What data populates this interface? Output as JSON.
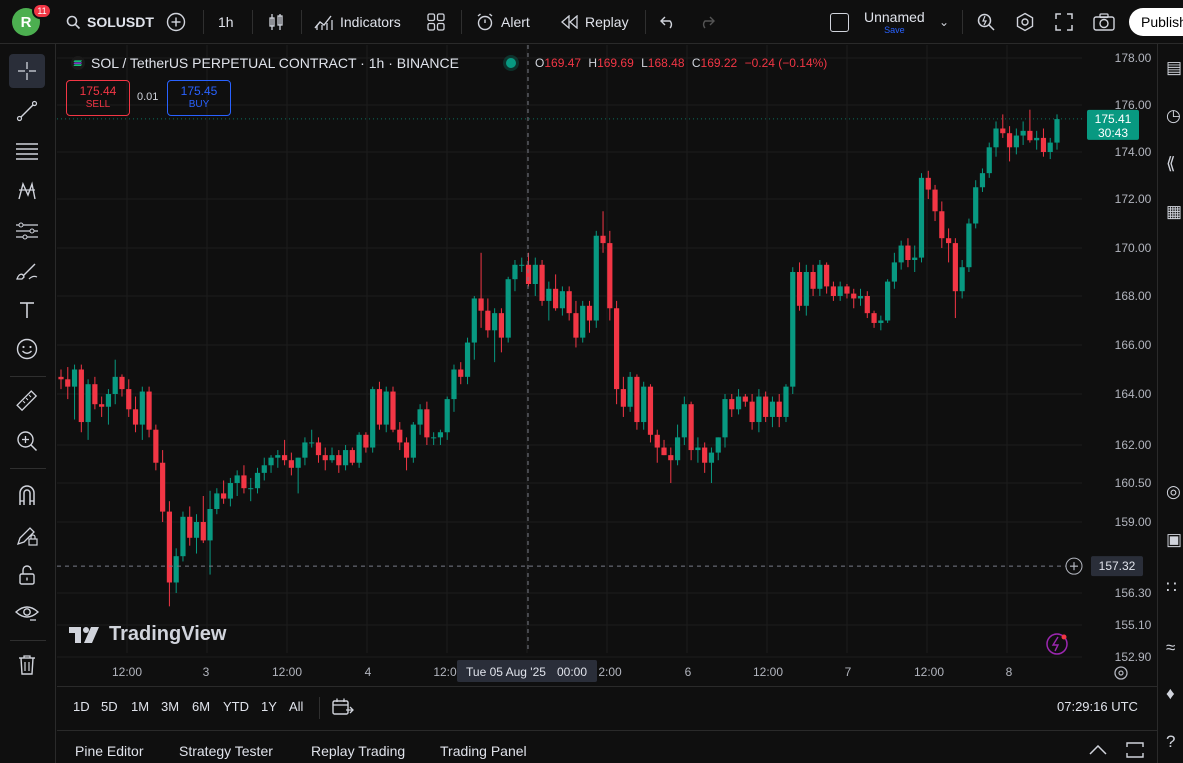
{
  "header": {
    "avatar_letter": "R",
    "notification_count": "11",
    "symbol": "SOLUSDT",
    "interval": "1h",
    "indicators_label": "Indicators",
    "alert_label": "Alert",
    "replay_label": "Replay",
    "layout_name": "Unnamed",
    "save_label": "Save",
    "publish_label": "Publish"
  },
  "legend": {
    "title": "SOL / TetherUS PERPETUAL CONTRACT · 1h · BINANCE",
    "open_key": "O",
    "open": "169.47",
    "high_key": "H",
    "high": "169.69",
    "low_key": "L",
    "low": "168.48",
    "close_key": "C",
    "close": "169.22",
    "change": "−0.24 (−0.14%)"
  },
  "trade": {
    "sell_price": "175.44",
    "sell_label": "SELL",
    "spread": "0.01",
    "buy_price": "175.45",
    "buy_label": "BUY"
  },
  "price_axis": {
    "ticks": [
      "178.00",
      "176.00",
      "174.00",
      "172.00",
      "170.00",
      "168.00",
      "166.00",
      "164.00",
      "162.00",
      "160.50",
      "159.00",
      "156.30",
      "155.10",
      "152.90"
    ],
    "last_price": "175.41",
    "countdown": "30:43",
    "crosshair_price": "157.32"
  },
  "time_axis": {
    "labels": [
      "12:00",
      "3",
      "12:00",
      "4",
      "12:0",
      "2:00",
      "6",
      "12:00",
      "7",
      "12:00",
      "8"
    ],
    "crosshair_date": "Tue 05 Aug '25",
    "crosshair_time": "00:00"
  },
  "watermark": "TradingView",
  "ranges": [
    "1D",
    "5D",
    "1M",
    "3M",
    "6M",
    "YTD",
    "1Y",
    "All"
  ],
  "clock": "07:29:16 UTC",
  "bottom_tabs": [
    "Pine Editor",
    "Strategy Tester",
    "Replay Trading",
    "Trading Panel"
  ],
  "colors": {
    "up": "#089981",
    "down": "#f23645",
    "background": "#0f0f0f",
    "accent": "#2962ff"
  },
  "chart_data": {
    "type": "candlestick",
    "symbol": "SOLUSDT",
    "interval": "1h",
    "ylim": [
      152.9,
      178.0
    ],
    "candles": [
      [
        164.7,
        165.0,
        164.2,
        164.6
      ],
      [
        164.6,
        165.1,
        163.8,
        164.3
      ],
      [
        164.3,
        165.2,
        163.0,
        165.0
      ],
      [
        165.0,
        165.2,
        162.5,
        162.9
      ],
      [
        162.9,
        164.6,
        162.2,
        164.4
      ],
      [
        164.4,
        164.7,
        163.4,
        163.6
      ],
      [
        163.6,
        163.9,
        163.1,
        163.5
      ],
      [
        163.5,
        164.2,
        162.8,
        164.0
      ],
      [
        164.0,
        165.4,
        163.6,
        164.7
      ],
      [
        164.7,
        164.8,
        163.9,
        164.2
      ],
      [
        164.2,
        164.6,
        163.1,
        163.4
      ],
      [
        163.4,
        163.9,
        162.5,
        162.8
      ],
      [
        162.8,
        164.3,
        162.2,
        164.1
      ],
      [
        164.1,
        164.3,
        162.3,
        162.6
      ],
      [
        162.6,
        162.8,
        161.0,
        161.3
      ],
      [
        161.3,
        161.8,
        159.0,
        159.4
      ],
      [
        159.4,
        159.8,
        155.8,
        156.7
      ],
      [
        156.7,
        158.0,
        156.3,
        157.7
      ],
      [
        157.7,
        159.4,
        157.5,
        159.2
      ],
      [
        159.2,
        159.6,
        158.1,
        158.4
      ],
      [
        158.4,
        159.3,
        157.8,
        159.0
      ],
      [
        159.0,
        160.0,
        158.2,
        158.3
      ],
      [
        158.3,
        160.2,
        157.0,
        159.5
      ],
      [
        159.5,
        160.3,
        159.3,
        160.1
      ],
      [
        160.1,
        160.6,
        159.7,
        159.9
      ],
      [
        159.9,
        160.7,
        159.6,
        160.5
      ],
      [
        160.5,
        161.0,
        160.0,
        160.8
      ],
      [
        160.8,
        161.2,
        160.1,
        160.3
      ],
      [
        160.3,
        160.7,
        159.8,
        160.3
      ],
      [
        160.3,
        161.1,
        160.1,
        160.9
      ],
      [
        160.9,
        161.5,
        160.6,
        161.2
      ],
      [
        161.2,
        161.6,
        160.9,
        161.5
      ],
      [
        161.5,
        161.8,
        161.1,
        161.6
      ],
      [
        161.6,
        162.2,
        161.2,
        161.4
      ],
      [
        161.4,
        161.7,
        160.8,
        161.1
      ],
      [
        161.1,
        161.5,
        160.1,
        161.5
      ],
      [
        161.5,
        162.3,
        161.2,
        162.1
      ],
      [
        162.1,
        162.6,
        161.9,
        162.1
      ],
      [
        162.1,
        162.3,
        161.3,
        161.6
      ],
      [
        161.6,
        161.9,
        161.0,
        161.4
      ],
      [
        161.4,
        161.9,
        161.3,
        161.6
      ],
      [
        161.6,
        161.8,
        160.9,
        161.2
      ],
      [
        161.2,
        162.0,
        161.0,
        161.8
      ],
      [
        161.8,
        161.9,
        161.2,
        161.3
      ],
      [
        161.3,
        162.5,
        161.1,
        162.4
      ],
      [
        162.4,
        162.5,
        161.7,
        161.9
      ],
      [
        161.9,
        164.3,
        161.7,
        164.2
      ],
      [
        164.2,
        164.5,
        162.6,
        162.8
      ],
      [
        162.8,
        164.3,
        162.5,
        164.1
      ],
      [
        164.1,
        164.3,
        162.5,
        162.6
      ],
      [
        162.6,
        162.9,
        161.8,
        162.1
      ],
      [
        162.1,
        162.3,
        161.0,
        161.5
      ],
      [
        161.5,
        162.9,
        161.3,
        162.8
      ],
      [
        162.8,
        163.6,
        162.4,
        163.4
      ],
      [
        163.4,
        163.7,
        162.0,
        162.3
      ],
      [
        162.3,
        162.5,
        162.0,
        162.3
      ],
      [
        162.3,
        162.6,
        162.0,
        162.5
      ],
      [
        162.5,
        163.9,
        162.2,
        163.8
      ],
      [
        163.8,
        165.2,
        163.3,
        165.0
      ],
      [
        165.0,
        165.3,
        164.4,
        164.7
      ],
      [
        164.7,
        166.3,
        164.4,
        166.1
      ],
      [
        166.1,
        168.0,
        165.4,
        167.9
      ],
      [
        167.9,
        169.8,
        166.7,
        167.4
      ],
      [
        167.4,
        167.9,
        166.3,
        166.6
      ],
      [
        166.6,
        167.5,
        165.3,
        167.3
      ],
      [
        167.3,
        167.5,
        165.7,
        166.3
      ],
      [
        166.3,
        168.8,
        166.1,
        168.7
      ],
      [
        168.7,
        169.5,
        168.2,
        169.3
      ],
      [
        169.3,
        169.6,
        169.0,
        169.3
      ],
      [
        169.3,
        169.8,
        168.4,
        168.5
      ],
      [
        168.5,
        169.6,
        168.0,
        169.3
      ],
      [
        169.3,
        169.5,
        167.6,
        167.8
      ],
      [
        167.8,
        168.6,
        167.0,
        168.3
      ],
      [
        168.3,
        168.9,
        167.4,
        167.5
      ],
      [
        167.5,
        168.4,
        167.2,
        168.2
      ],
      [
        168.2,
        168.4,
        167.0,
        167.3
      ],
      [
        167.3,
        167.8,
        165.9,
        166.3
      ],
      [
        166.3,
        167.8,
        166.1,
        167.6
      ],
      [
        167.6,
        167.8,
        166.5,
        167.0
      ],
      [
        167.0,
        170.7,
        166.7,
        170.5
      ],
      [
        170.5,
        171.5,
        169.8,
        170.2
      ],
      [
        170.2,
        170.7,
        167.0,
        167.5
      ],
      [
        167.5,
        167.8,
        163.6,
        164.2
      ],
      [
        164.2,
        164.7,
        163.1,
        163.5
      ],
      [
        163.5,
        164.9,
        163.3,
        164.7
      ],
      [
        164.7,
        164.8,
        162.6,
        162.9
      ],
      [
        162.9,
        164.5,
        162.6,
        164.3
      ],
      [
        164.3,
        164.4,
        162.1,
        162.4
      ],
      [
        162.4,
        162.6,
        161.3,
        161.9
      ],
      [
        161.9,
        162.2,
        161.6,
        161.6
      ],
      [
        161.6,
        161.9,
        160.5,
        161.4
      ],
      [
        161.4,
        162.8,
        161.2,
        162.3
      ],
      [
        162.3,
        163.9,
        162.0,
        163.6
      ],
      [
        163.6,
        163.7,
        161.4,
        161.8
      ],
      [
        161.8,
        162.3,
        161.3,
        161.9
      ],
      [
        161.9,
        162.1,
        160.9,
        161.3
      ],
      [
        161.3,
        161.9,
        160.5,
        161.7
      ],
      [
        161.7,
        162.3,
        161.4,
        162.3
      ],
      [
        162.3,
        164.0,
        161.9,
        163.8
      ],
      [
        163.8,
        164.0,
        163.1,
        163.4
      ],
      [
        163.4,
        164.2,
        163.2,
        163.9
      ],
      [
        163.9,
        164.0,
        163.5,
        163.7
      ],
      [
        163.7,
        164.0,
        162.6,
        162.9
      ],
      [
        162.9,
        164.2,
        162.5,
        163.9
      ],
      [
        163.9,
        164.1,
        162.9,
        163.1
      ],
      [
        163.1,
        163.9,
        162.7,
        163.7
      ],
      [
        163.7,
        164.0,
        162.7,
        163.1
      ],
      [
        163.1,
        164.4,
        162.9,
        164.3
      ],
      [
        164.3,
        169.2,
        164.0,
        169.0
      ],
      [
        169.0,
        169.4,
        167.4,
        167.6
      ],
      [
        167.6,
        169.3,
        167.2,
        169.0
      ],
      [
        169.0,
        169.3,
        168.0,
        168.3
      ],
      [
        168.3,
        169.5,
        168.0,
        169.3
      ],
      [
        169.3,
        169.4,
        168.1,
        168.4
      ],
      [
        168.4,
        168.6,
        167.8,
        168.0
      ],
      [
        168.0,
        168.6,
        167.8,
        168.4
      ],
      [
        168.4,
        168.5,
        167.9,
        168.1
      ],
      [
        168.1,
        168.3,
        167.5,
        167.9
      ],
      [
        167.9,
        168.3,
        167.6,
        168.0
      ],
      [
        168.0,
        168.2,
        167.1,
        167.3
      ],
      [
        167.3,
        167.4,
        166.7,
        166.9
      ],
      [
        166.9,
        167.2,
        166.6,
        167.0
      ],
      [
        167.0,
        168.7,
        166.9,
        168.6
      ],
      [
        168.6,
        169.8,
        168.3,
        169.4
      ],
      [
        169.4,
        170.3,
        169.1,
        170.1
      ],
      [
        170.1,
        170.4,
        169.2,
        169.5
      ],
      [
        169.5,
        170.1,
        169.0,
        169.6
      ],
      [
        169.6,
        173.1,
        169.4,
        172.9
      ],
      [
        172.9,
        173.2,
        172.0,
        172.4
      ],
      [
        172.4,
        172.6,
        171.1,
        171.5
      ],
      [
        171.5,
        171.9,
        170.0,
        170.4
      ],
      [
        170.4,
        170.8,
        169.4,
        170.2
      ],
      [
        170.2,
        170.4,
        167.1,
        168.2
      ],
      [
        168.2,
        169.5,
        167.9,
        169.2
      ],
      [
        169.2,
        171.2,
        169.0,
        171.0
      ],
      [
        171.0,
        172.8,
        170.8,
        172.5
      ],
      [
        172.5,
        173.3,
        172.3,
        173.1
      ],
      [
        173.1,
        174.4,
        172.9,
        174.2
      ],
      [
        174.2,
        175.3,
        173.8,
        175.0
      ],
      [
        175.0,
        175.6,
        174.6,
        174.8
      ],
      [
        174.8,
        175.1,
        173.6,
        174.2
      ],
      [
        174.2,
        175.0,
        173.9,
        174.7
      ],
      [
        174.7,
        175.3,
        174.3,
        174.9
      ],
      [
        174.9,
        175.8,
        174.4,
        174.5
      ],
      [
        174.5,
        174.9,
        174.1,
        174.6
      ],
      [
        174.6,
        175.0,
        173.8,
        174.0
      ],
      [
        174.0,
        174.6,
        173.7,
        174.4
      ],
      [
        174.4,
        175.6,
        174.1,
        175.4
      ]
    ],
    "last_price": 175.41,
    "crosshair_price": 157.32
  }
}
